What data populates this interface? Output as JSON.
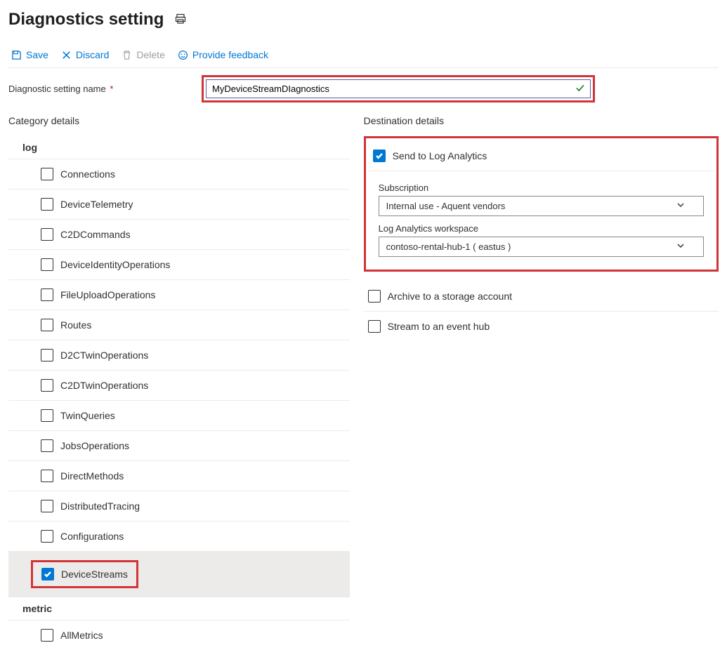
{
  "header": {
    "title": "Diagnostics setting"
  },
  "toolbar": {
    "save": "Save",
    "discard": "Discard",
    "delete": "Delete",
    "feedback": "Provide feedback"
  },
  "form": {
    "name_label": "Diagnostic setting name",
    "name_value": "MyDeviceStreamDIagnostics"
  },
  "left": {
    "section_title": "Category details",
    "group_log": "log",
    "group_metric": "metric",
    "logs": [
      {
        "label": "Connections",
        "checked": false
      },
      {
        "label": "DeviceTelemetry",
        "checked": false
      },
      {
        "label": "C2DCommands",
        "checked": false
      },
      {
        "label": "DeviceIdentityOperations",
        "checked": false
      },
      {
        "label": "FileUploadOperations",
        "checked": false
      },
      {
        "label": "Routes",
        "checked": false
      },
      {
        "label": "D2CTwinOperations",
        "checked": false
      },
      {
        "label": "C2DTwinOperations",
        "checked": false
      },
      {
        "label": "TwinQueries",
        "checked": false
      },
      {
        "label": "JobsOperations",
        "checked": false
      },
      {
        "label": "DirectMethods",
        "checked": false
      },
      {
        "label": "DistributedTracing",
        "checked": false
      },
      {
        "label": "Configurations",
        "checked": false
      },
      {
        "label": "DeviceStreams",
        "checked": true
      }
    ],
    "metrics": [
      {
        "label": "AllMetrics",
        "checked": false
      }
    ]
  },
  "right": {
    "section_title": "Destination details",
    "dest_log_analytics": "Send to Log Analytics",
    "dest_storage": "Archive to a storage account",
    "dest_eventhub": "Stream to an event hub",
    "subscription_label": "Subscription",
    "subscription_value": "Internal use - Aquent vendors",
    "workspace_label": "Log Analytics workspace",
    "workspace_value": "contoso-rental-hub-1 ( eastus )"
  }
}
